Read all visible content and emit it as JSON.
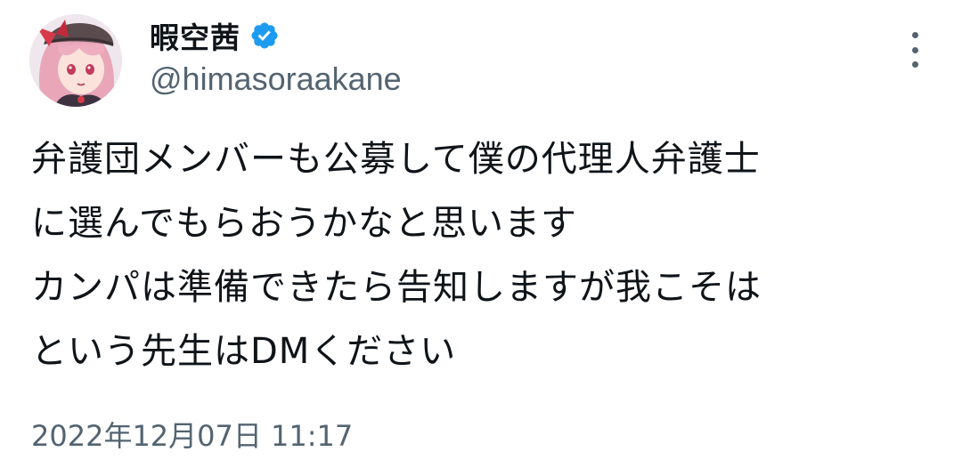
{
  "user": {
    "display_name": "暇空茜",
    "handle": "@himasoraakane",
    "verified": true,
    "avatar_icon": "avatar-illustration"
  },
  "tweet": {
    "lines": [
      "弁護団メンバーも公募して僕の代理人弁護士",
      "に選んでもらおうかなと思います",
      "カンパは準備できたら告知しますが我こそは",
      "という先生はDMください"
    ],
    "timestamp": "2022年12月07日 11:17"
  },
  "colors": {
    "verified_blue": "#1d9bf0",
    "secondary_text": "#536471",
    "primary_text": "#0f1419"
  },
  "icons": {
    "verified": "verified-badge-icon",
    "more": "more-vertical-icon"
  }
}
